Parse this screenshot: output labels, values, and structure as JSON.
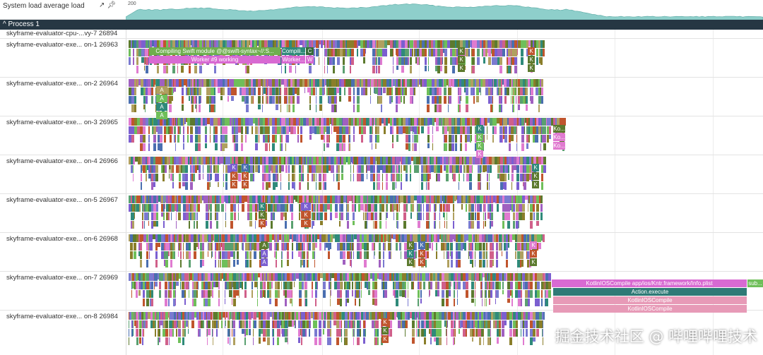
{
  "system_load": {
    "label": "System load average load",
    "axis_max_label": "200",
    "icons": [
      "chart-line-icon",
      "pin-icon"
    ],
    "area_color": "#8ecfcb"
  },
  "process": {
    "label": "^ Process 1"
  },
  "tracks": [
    {
      "label": "skyframe-evaluator-cpu-...vy-7 26894"
    },
    {
      "label": "skyframe-evaluator-exe... on-1 26963"
    },
    {
      "label": "skyframe-evaluator-exe... on-2 26964"
    },
    {
      "label": "skyframe-evaluator-exe... on-3 26965"
    },
    {
      "label": "skyframe-evaluator-exe... on-4 26966"
    },
    {
      "label": "skyframe-evaluator-exe... on-5 26967"
    },
    {
      "label": "skyframe-evaluator-exe... on-6 26968"
    },
    {
      "label": "skyframe-evaluator-exe... on-7 26969"
    },
    {
      "label": "skyframe-evaluator-exe... on-8 26984"
    }
  ],
  "slices": {
    "t1_compiling": "Compiling Swift module @@swift-syntax~//:S...",
    "t1_compi2": "Compili...",
    "t1_c": "C",
    "t1_worker": "Worker #9 working",
    "t1_worker2": "Worker...",
    "t1_w": "W",
    "k": "K",
    "a": "A",
    "ko": "Ko...",
    "t7_kotlin": "KotlinIOSCompile app/ios/Kntr.framework/Info.plist",
    "t7_sub": "sub...",
    "t7_action": "Action.execute",
    "t7_kotlin2": "KotlinIOSCompile",
    "t7_kotlin3": "KotlinIOSCompile"
  },
  "palette": [
    "#7b5fd0",
    "#c0552d",
    "#5c7a2e",
    "#6fbf5a",
    "#e07bd0",
    "#8a7e2a",
    "#4a6fb0",
    "#2f8a7a",
    "#b0a060",
    "#7a7ad0",
    "#d0608a",
    "#a060c0",
    "#5aa070"
  ],
  "watermark": "掘金技术社区 @ 哔哩哔哩技术"
}
